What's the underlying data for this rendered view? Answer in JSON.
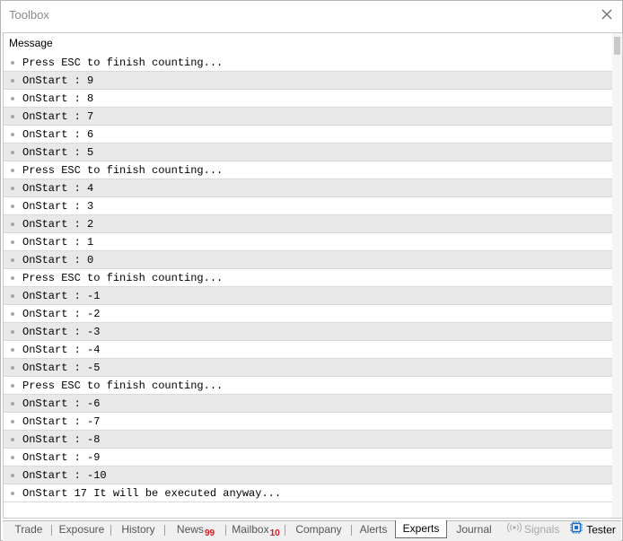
{
  "window": {
    "title": "Toolbox"
  },
  "table": {
    "column_header": "Message",
    "rows": [
      "Press ESC to finish counting...",
      "OnStart : 9",
      "OnStart : 8",
      "OnStart : 7",
      "OnStart : 6",
      "OnStart : 5",
      "Press ESC to finish counting...",
      "OnStart : 4",
      "OnStart : 3",
      "OnStart : 2",
      "OnStart : 1",
      "OnStart : 0",
      "Press ESC to finish counting...",
      "OnStart : -1",
      "OnStart : -2",
      "OnStart : -3",
      "OnStart : -4",
      "OnStart : -5",
      "Press ESC to finish counting...",
      "OnStart : -6",
      "OnStart : -7",
      "OnStart : -8",
      "OnStart : -9",
      "OnStart : -10",
      "OnStart 17 It will be executed anyway..."
    ]
  },
  "tabs": [
    {
      "label": "Trade"
    },
    {
      "label": "Exposure"
    },
    {
      "label": "History"
    },
    {
      "label": "News",
      "badge": "99"
    },
    {
      "label": "Mailbox",
      "badge": "10"
    },
    {
      "label": "Company"
    },
    {
      "label": "Alerts"
    },
    {
      "label": "Experts",
      "active": true
    },
    {
      "label": "Journal"
    },
    {
      "label": "Signals",
      "disabled": true,
      "icon": "signal-icon"
    },
    {
      "label": "Tester",
      "icon": "chip-icon"
    }
  ],
  "colors": {
    "row_alt": "#e8e8e8",
    "badge": "#e0141e",
    "chip_icon": "#1a6fc4"
  }
}
